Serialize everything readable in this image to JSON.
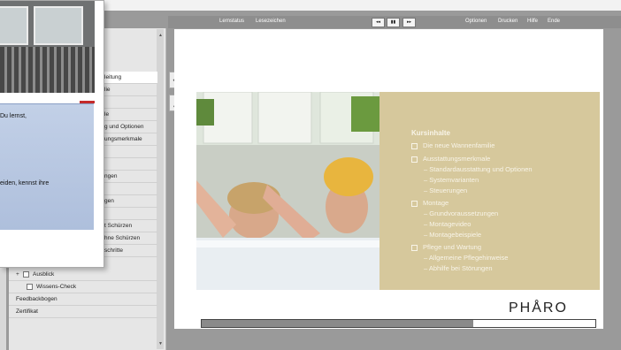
{
  "toolbar": {
    "lernstatus": "Lernstatus",
    "lesezeichen": "Lesezeichen",
    "rewind": "◂◂",
    "pause": "▮▮",
    "forward": "▸▸",
    "optionen": "Optionen",
    "drucken": "Drucken",
    "hilfe": "Hilfe",
    "ende": "Ende"
  },
  "popup": {
    "line1": "Du lernst,",
    "line2": "eiden, kennst ihre"
  },
  "menu": {
    "rows": [
      "leitung",
      "lie",
      "",
      "le",
      "g und Optionen",
      "ungsmerkmale",
      "",
      "",
      "ngen",
      "",
      "gen",
      "",
      "t Schürzen",
      "hne Schürzen",
      "schritte"
    ],
    "ausblick": "Ausblick",
    "plus": "+",
    "wissens_check": "Wissens-Check",
    "feedbackbogen": "Feedbackbogen",
    "zertifikat": "Zertifikat"
  },
  "slide": {
    "heading": "Kursinhalte",
    "items": {
      "i1": "Die neue Wannenfamilie",
      "i2": "Ausstattungsmerkmale",
      "i2a": "– Standardausstattung und Optionen",
      "i2b": "– Systemvarianten",
      "i2c": "– Steuerungen",
      "i3": "Montage",
      "i3a": "– Grundvoraussetzungen",
      "i3b": "– Montagevideo",
      "i3c": "– Montagebeispiele",
      "i4": "Pflege und Wartung",
      "i4a": "– Allgemeine Pflegehinweise",
      "i4b": "– Abhilfe bei Störungen"
    },
    "logo": "PHÅRO"
  },
  "progress": {
    "fraction": 0.69
  },
  "colors": {
    "info_bg": "#d6c89c",
    "popup_text_bg": "#b7c7e2",
    "toolbar_bg": "#8e8e8e",
    "accent_red": "#c42b2b"
  },
  "icons": {
    "tool1": "eraser-icon",
    "tool2": "pen-icon"
  }
}
